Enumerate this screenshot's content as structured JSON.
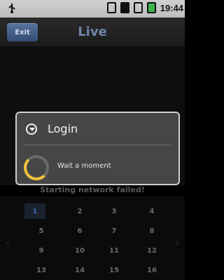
{
  "status_bar": {
    "time": "19:44",
    "icons": [
      "usb-icon",
      "signal-icon",
      "data-icon",
      "signal-bars-icon",
      "battery-icon"
    ]
  },
  "header": {
    "exit_label": "Exit",
    "title": "Live"
  },
  "network": {
    "status": "Starting network failed!"
  },
  "grid": {
    "cells": [
      "1",
      "2",
      "3",
      "4",
      "5",
      "6",
      "7",
      "8",
      "9",
      "10",
      "11",
      "12",
      "13",
      "14",
      "15",
      "16"
    ],
    "selected": "1"
  },
  "dialog": {
    "title": "Login",
    "message": "Wait a moment"
  },
  "colors": {
    "accent": "#6e86aa",
    "exit_button": "#3f5a86",
    "spinner": "#f1c33a"
  }
}
